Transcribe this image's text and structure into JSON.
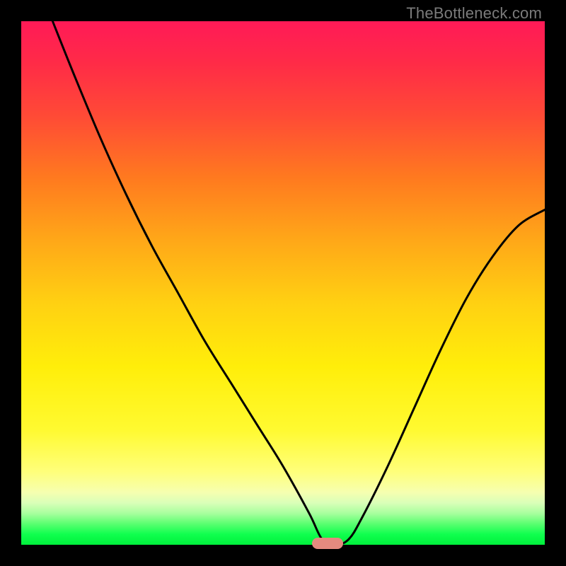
{
  "watermark": "TheBottleneck.com",
  "colors": {
    "frame": "#000000",
    "curve": "#000000",
    "marker": "#e58a7f",
    "watermark_text": "#7b7b7b"
  },
  "chart_data": {
    "type": "line",
    "title": "",
    "xlabel": "",
    "ylabel": "",
    "xlim": [
      0,
      1
    ],
    "ylim": [
      0,
      1
    ],
    "grid": false,
    "legend": false,
    "background_gradient": [
      {
        "stop": 0.0,
        "color": "#ff1a57"
      },
      {
        "stop": 0.08,
        "color": "#ff2b47"
      },
      {
        "stop": 0.18,
        "color": "#ff4a36"
      },
      {
        "stop": 0.3,
        "color": "#ff7a1f"
      },
      {
        "stop": 0.42,
        "color": "#ffa818"
      },
      {
        "stop": 0.54,
        "color": "#ffd112"
      },
      {
        "stop": 0.66,
        "color": "#ffee0a"
      },
      {
        "stop": 0.78,
        "color": "#fffa30"
      },
      {
        "stop": 0.86,
        "color": "#ffff7a"
      },
      {
        "stop": 0.9,
        "color": "#f6ffb0"
      },
      {
        "stop": 0.92,
        "color": "#d9ffb8"
      },
      {
        "stop": 0.94,
        "color": "#a8ff9e"
      },
      {
        "stop": 0.96,
        "color": "#5aff70"
      },
      {
        "stop": 0.98,
        "color": "#10ff4e"
      },
      {
        "stop": 1.0,
        "color": "#00f03c"
      }
    ],
    "series": [
      {
        "name": "bottleneck-curve",
        "x": [
          0.06,
          0.1,
          0.15,
          0.2,
          0.25,
          0.3,
          0.35,
          0.4,
          0.45,
          0.5,
          0.55,
          0.575,
          0.6,
          0.625,
          0.65,
          0.7,
          0.75,
          0.8,
          0.85,
          0.9,
          0.95,
          1.0
        ],
        "y": [
          1.0,
          0.9,
          0.78,
          0.67,
          0.57,
          0.48,
          0.39,
          0.31,
          0.23,
          0.15,
          0.06,
          0.01,
          0.0,
          0.01,
          0.05,
          0.15,
          0.26,
          0.37,
          0.47,
          0.55,
          0.61,
          0.64
        ]
      }
    ],
    "marker": {
      "x": 0.585,
      "y": 0.0,
      "shape": "rounded-rect"
    }
  }
}
